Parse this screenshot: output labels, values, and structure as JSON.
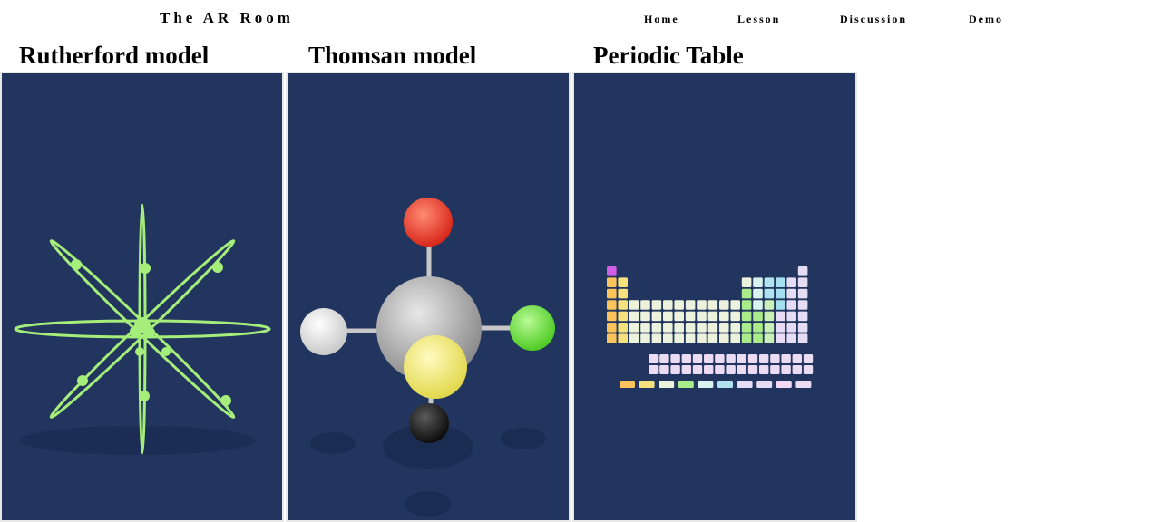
{
  "header": {
    "brand": "The AR Room",
    "nav": [
      "Home",
      "Lesson",
      "Discussion",
      "Demo"
    ]
  },
  "cards": [
    {
      "title": "Rutherford model"
    },
    {
      "title": "Thomsan model"
    },
    {
      "title": "Periodic Table"
    }
  ],
  "colors": {
    "viewer_bg": "#21355f",
    "electron_green": "#a6ee7a",
    "oxygen_red": "#f2412e",
    "core_gray": "#b5b5b5",
    "sulfur_yellow": "#f6ed82",
    "carbon_black": "#1a1a1a",
    "chlorine_green": "#68e33c"
  }
}
